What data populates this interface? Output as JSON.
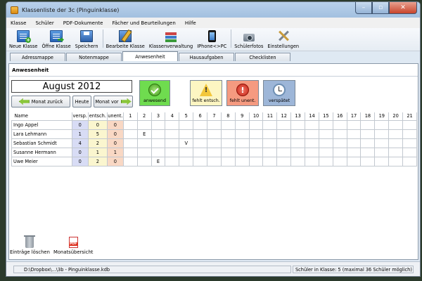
{
  "window": {
    "title": "Klassenliste der 3c (Pinguinklasse)"
  },
  "menu": [
    "Klasse",
    "Schüler",
    "PDF-Dokumente",
    "Fächer und Beurteilungen",
    "Hilfe"
  ],
  "toolbar": {
    "neue_klasse": "Neue Klasse",
    "oeffne_klasse": "Öffne Klasse",
    "speichern": "Speichern",
    "bearbeite_klasse": "Bearbeite Klasse",
    "klassenverwaltung": "Klassenverwaltung",
    "iphone_pc": "IPhone<>PC",
    "schuelerfotos": "Schülerfotos",
    "einstellungen": "Einstellungen"
  },
  "tabs": [
    "Adressmappe",
    "Notenmappe",
    "Anwesenheit",
    "Hausaufgaben",
    "Checklisten"
  ],
  "active_tab": "Anwesenheit",
  "panel": {
    "heading": "Anwesenheit",
    "month": "August 2012",
    "btn_prev": "Monat zurück",
    "btn_today": "Heute",
    "btn_next": "Monat vor",
    "status": {
      "present": "anwesend",
      "excused": "fehlt entsch.",
      "unexcused": "fehlt unent.",
      "late": "verspätet"
    },
    "status_colors": {
      "present": "#6fdc4f",
      "excused": "#fdf6c2",
      "unexcused": "#f59a80",
      "late": "#9db6d8"
    }
  },
  "grid": {
    "headers": [
      "Name",
      "versp.",
      "entsch.",
      "unent.",
      "1",
      "2",
      "3",
      "4",
      "5",
      "6",
      "7",
      "8",
      "9",
      "10",
      "11",
      "12",
      "13",
      "14",
      "15",
      "16",
      "17",
      "18",
      "19",
      "20",
      "21"
    ],
    "rows": [
      {
        "name": "Ingo Appel",
        "versp": "0",
        "entsch": "0",
        "unent": "0",
        "days": [
          "",
          "",
          "",
          "",
          "",
          "",
          "",
          "",
          "",
          "",
          "",
          "",
          "",
          "",
          "",
          "",
          "",
          "",
          "",
          "",
          ""
        ]
      },
      {
        "name": "Lara Lehmann",
        "versp": "1",
        "entsch": "5",
        "unent": "0",
        "days": [
          "",
          "E",
          "",
          "",
          "",
          "",
          "",
          "",
          "",
          "",
          "",
          "",
          "",
          "",
          "",
          "",
          "",
          "",
          "",
          "",
          ""
        ]
      },
      {
        "name": "Sebastian Schmidt",
        "versp": "4",
        "entsch": "2",
        "unent": "0",
        "days": [
          "",
          "",
          "",
          "",
          "V",
          "",
          "",
          "",
          "",
          "",
          "",
          "",
          "",
          "",
          "",
          "",
          "",
          "",
          "",
          "",
          ""
        ]
      },
      {
        "name": "Susanne Hermann",
        "versp": "0",
        "entsch": "1",
        "unent": "1",
        "days": [
          "",
          "",
          "",
          "",
          "",
          "",
          "",
          "",
          "",
          "",
          "",
          "",
          "",
          "",
          "",
          "",
          "",
          "",
          "",
          "",
          ""
        ]
      },
      {
        "name": "Uwe Meier",
        "versp": "0",
        "entsch": "2",
        "unent": "0",
        "days": [
          "",
          "",
          "E",
          "",
          "",
          "",
          "",
          "",
          "",
          "",
          "",
          "",
          "",
          "",
          "",
          "",
          "",
          "",
          "",
          "",
          ""
        ]
      }
    ]
  },
  "bottom": {
    "delete": "Einträge löschen",
    "overview": "Monatsübersicht"
  },
  "statusbar": {
    "path": "D:\\Dropbox\\...\\3b - Pinguinklasse.kdb",
    "count": "Schüler in Klasse: 5 (maximal 36 Schüler möglich)"
  }
}
